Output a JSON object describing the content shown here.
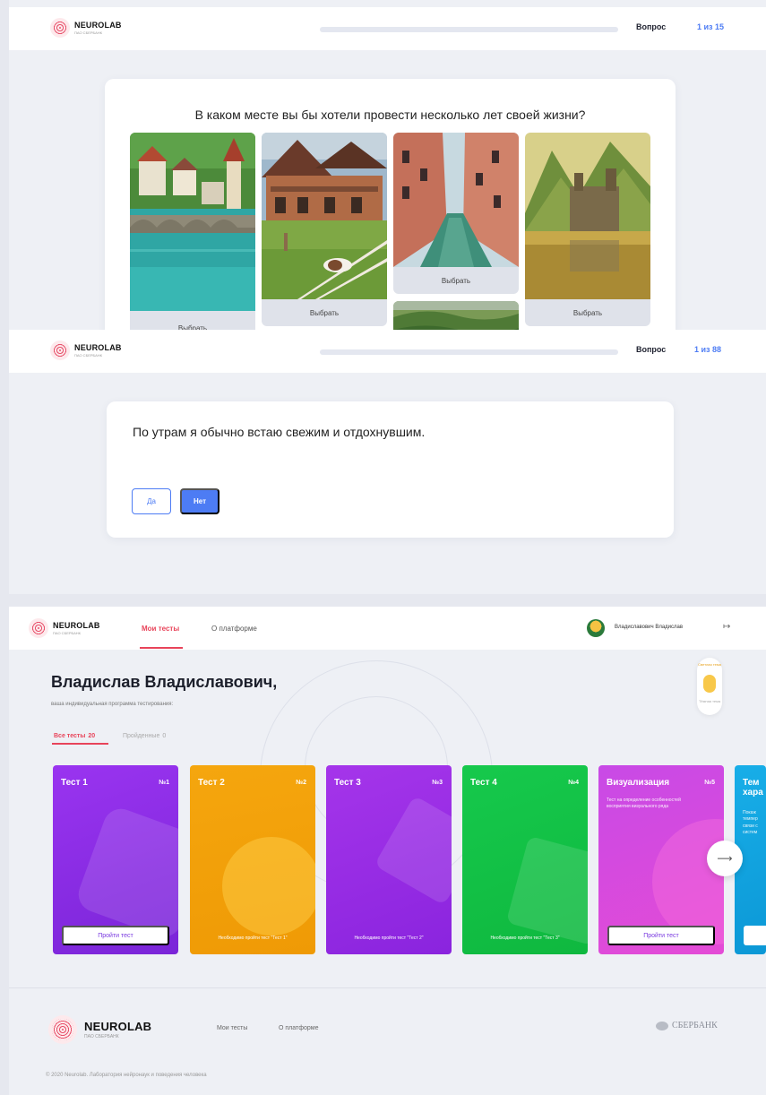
{
  "brand": {
    "name": "NEUROLAB",
    "sub": "ПАО СБЕРБАНК"
  },
  "screen1": {
    "question_label": "Вопрос",
    "question_count": "1 из 15",
    "question": "В каком месте вы бы хотели провести несколько лет своей жизни?",
    "choose_label": "Выбрать",
    "images": [
      "town-bridge-river",
      "ranch-house-horses",
      "venice-canal",
      "castle-lake-mountains",
      "green-hills"
    ]
  },
  "screen2": {
    "question_label": "Вопрос",
    "question_count": "1 из 88",
    "statement": "По утрам я обычно встаю свежим и отдохнувшим.",
    "yes": "Да",
    "no": "Нет"
  },
  "screen3": {
    "nav": {
      "my_tests": "Мои тесты",
      "about": "О платформе"
    },
    "user_name": "Владиславович Владислав",
    "greeting": "Владислав Владиславович,",
    "greeting_sub": "ваша индивидуальная программа тестирования:",
    "tabs": {
      "all_label": "Все тесты",
      "all_count": "20",
      "done_label": "Пройденные",
      "done_count": "0"
    },
    "theme": {
      "light": "Светлая тема",
      "dark": "Тёмная тема"
    },
    "cards": [
      {
        "title": "Тест 1",
        "num": "№1",
        "button": "Пройти тест",
        "color": "#8c2fe8"
      },
      {
        "title": "Тест 2",
        "num": "№2",
        "requirement": "Необходимо пройти тест \"Тест 1\"",
        "color": "#f2a20a"
      },
      {
        "title": "Тест 3",
        "num": "№3",
        "requirement": "Необходимо пройти тест \"Тест 2\"",
        "color": "#9b2be8"
      },
      {
        "title": "Тест 4",
        "num": "№4",
        "requirement": "Необходимо пройти тест \"Тест 3\"",
        "color": "#12c247"
      },
      {
        "title": "Визуализация",
        "num": "№5",
        "desc": "Тест на определение особенностей восприятия визуального ряда",
        "button": "Пройти тест",
        "color": "#d74ae6"
      },
      {
        "title": "Тем хара",
        "desc": "Покаж темпер связи с систем",
        "color": "#11a6e0"
      }
    ],
    "footer": {
      "my_tests": "Мои тесты",
      "about": "О платформе",
      "partner": "СБЕРБАНК",
      "copyright": "© 2020 Neurolab. Лаборатория нейронаук и поведения человека"
    }
  }
}
